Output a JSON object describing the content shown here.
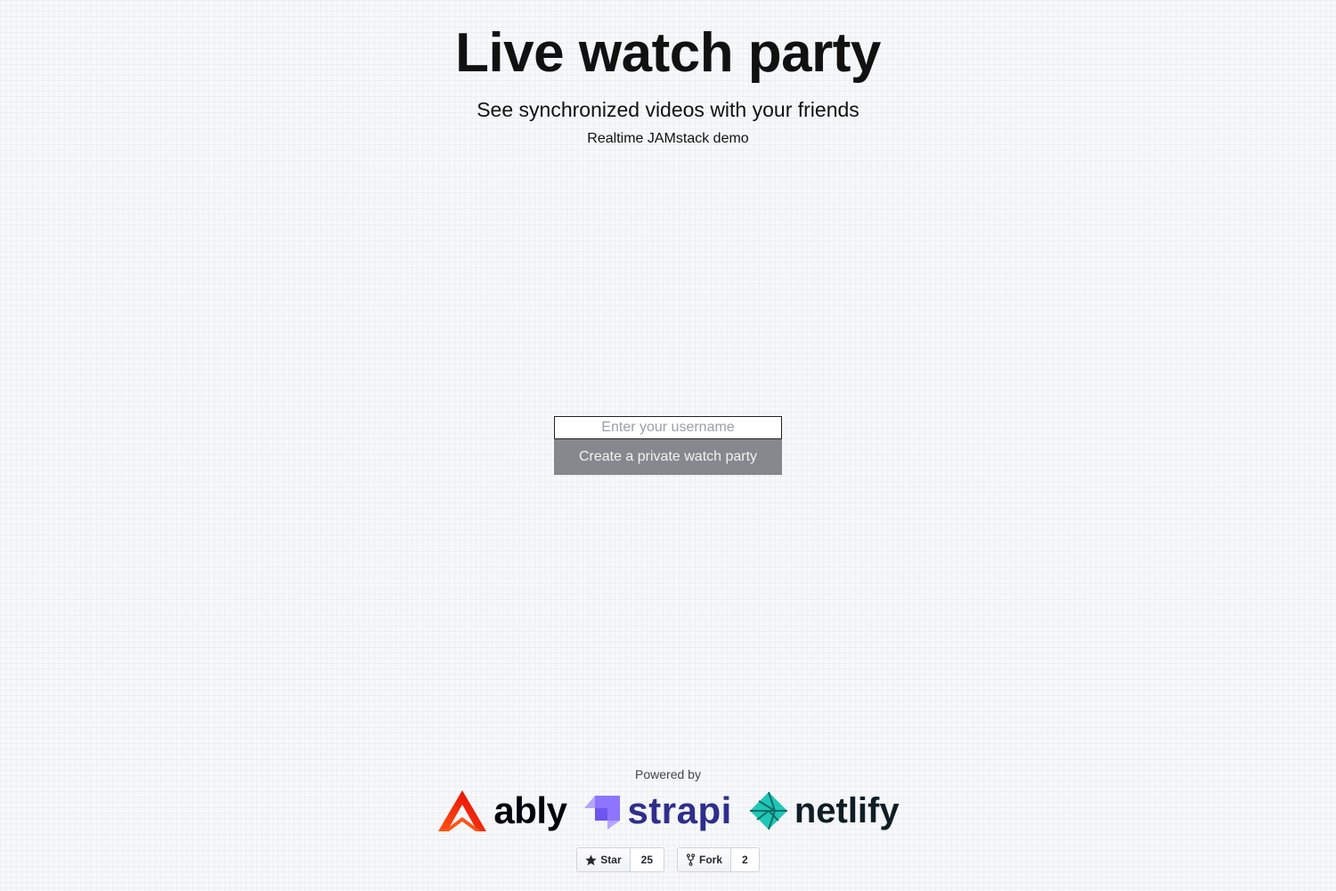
{
  "header": {
    "title": "Live watch party",
    "subtitle": "See synchronized videos with your friends",
    "tagline": "Realtime JAMstack demo"
  },
  "form": {
    "username_placeholder": "Enter your username",
    "username_value": "",
    "create_button_label": "Create a private watch party"
  },
  "footer": {
    "powered_by": "Powered by",
    "logos": [
      {
        "name": "ably",
        "text": "ably",
        "icon": "ably-logo-icon",
        "color": "#ff5416"
      },
      {
        "name": "strapi",
        "text": "strapi",
        "icon": "strapi-logo-icon",
        "color": "#8e75ff"
      },
      {
        "name": "netlify",
        "text": "netlify",
        "icon": "netlify-logo-icon",
        "color": "#20c6b7"
      }
    ],
    "github": {
      "star_label": "Star",
      "star_count": "25",
      "fork_label": "Fork",
      "fork_count": "2"
    }
  },
  "colors": {
    "button_bg": "#86888d",
    "strapi_text": "#2f2e8b",
    "background": "#f7f8fa"
  }
}
